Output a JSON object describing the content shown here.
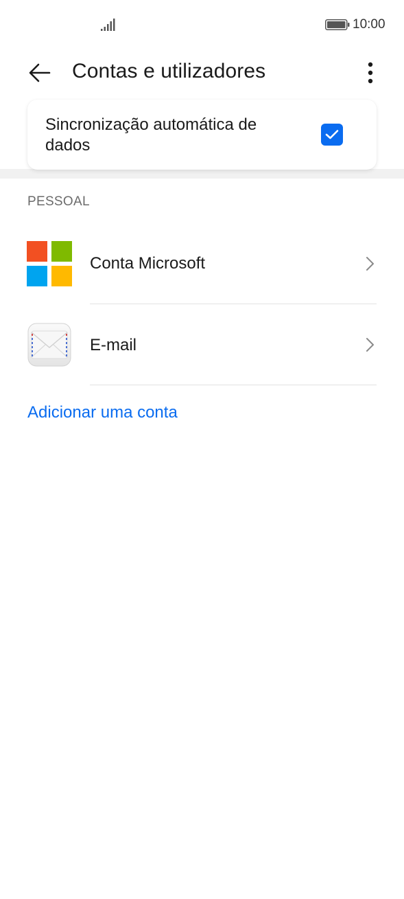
{
  "status_bar": {
    "time": "10:00",
    "signal_icon": "signal-bars-icon",
    "battery_icon": "battery-full-icon"
  },
  "app_bar": {
    "title": "Contas e utilizadores",
    "back_icon": "arrow-left-icon",
    "menu_icon": "more-vertical-icon"
  },
  "sync": {
    "label": "Sincronização automática de dados",
    "checked": true,
    "accent": "#0a6cf0"
  },
  "section": {
    "header": "PESSOAL"
  },
  "accounts": [
    {
      "label": "Conta Microsoft",
      "icon": "microsoft-logo-icon"
    },
    {
      "label": "E-mail",
      "icon": "envelope-icon"
    }
  ],
  "add_account": {
    "label": "Adicionar uma conta"
  },
  "colors": {
    "ms_red": "#f25022",
    "ms_green": "#7fba00",
    "ms_blue": "#00a4ef",
    "ms_yellow": "#ffb900"
  }
}
